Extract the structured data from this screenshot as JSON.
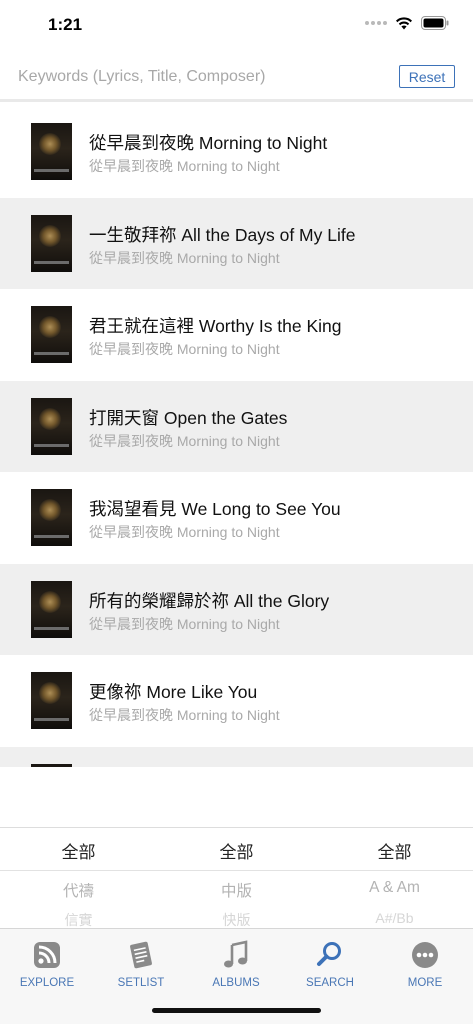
{
  "status_bar": {
    "time": "1:21"
  },
  "search": {
    "placeholder": "Keywords (Lyrics, Title, Composer)",
    "value": "",
    "reset_label": "Reset"
  },
  "songs": [
    {
      "title": "從早晨到夜晚 Morning to Night",
      "album": "從早晨到夜晚 Morning to Night"
    },
    {
      "title": "一生敬拜祢 All the Days of My Life",
      "album": "從早晨到夜晚 Morning to Night"
    },
    {
      "title": "君王就在這裡 Worthy Is the King",
      "album": "從早晨到夜晚 Morning to Night"
    },
    {
      "title": "打開天窗 Open the Gates",
      "album": "從早晨到夜晚 Morning to Night"
    },
    {
      "title": "我渴望看見 We Long to See You",
      "album": "從早晨到夜晚 Morning to Night"
    },
    {
      "title": "所有的榮耀歸於祢 All the Glory",
      "album": "從早晨到夜晚 Morning to Night"
    },
    {
      "title": "更像祢 More Like You",
      "album": "從早晨到夜晚 Morning to Night"
    }
  ],
  "filters": [
    {
      "selected": "全部",
      "next": "代禱",
      "after": "信實"
    },
    {
      "selected": "全部",
      "next": "中版",
      "after": "快版"
    },
    {
      "selected": "全部",
      "next": "A & Am",
      "after": "A#/Bb"
    }
  ],
  "tabs": [
    {
      "label": "EXPLORE",
      "icon": "explore-icon"
    },
    {
      "label": "SETLIST",
      "icon": "setlist-icon"
    },
    {
      "label": "ALBUMS",
      "icon": "music-note-icon"
    },
    {
      "label": "SEARCH",
      "icon": "search-icon"
    },
    {
      "label": "MORE",
      "icon": "more-icon"
    }
  ],
  "colors": {
    "accent": "#3d72b8",
    "row_alt": "#efefef",
    "secondary_text": "#a9a9a9"
  }
}
